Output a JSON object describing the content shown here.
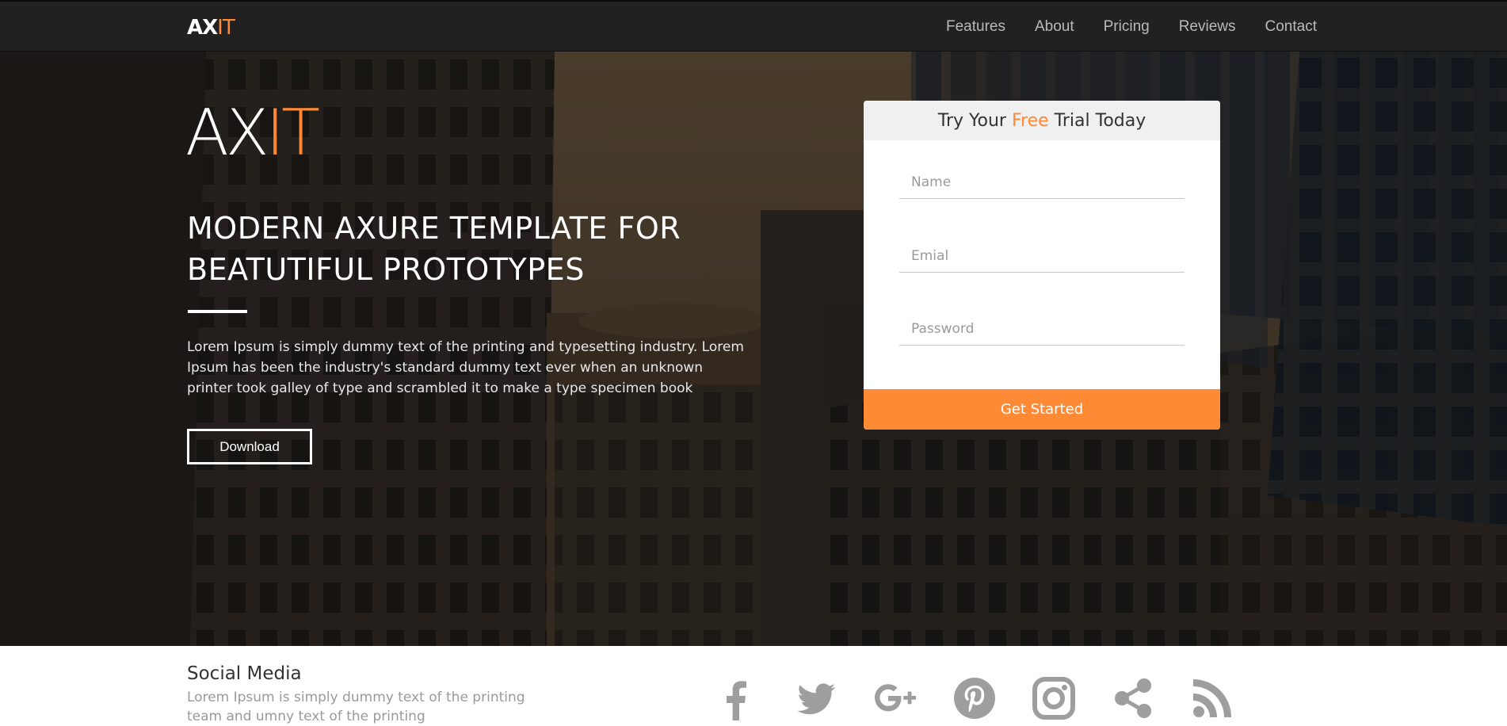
{
  "nav": {
    "brand_main": "AX",
    "brand_accent": "IT",
    "links": [
      "Features",
      "About",
      "Pricing",
      "Reviews",
      "Contact"
    ]
  },
  "hero": {
    "logo_main": "AX",
    "logo_accent": "IT",
    "title": "MODERN AXURE TEMPLATE FOR BEATUTIFUL PROTOTYPES",
    "body": "Lorem Ipsum is simply dummy text of the printing and typesetting industry. Lorem Ipsum has been the industry's standard dummy text ever when an unknown printer took galley of type and scrambled it to make a type specimen book",
    "download_label": "Download"
  },
  "trial": {
    "title_before": "Try Your ",
    "title_accent": "Free",
    "title_after": " Trial Today",
    "name_placeholder": "Name",
    "email_placeholder": "Emial",
    "password_placeholder": "Password",
    "cta_label": "Get Started"
  },
  "social": {
    "title": "Social Media",
    "text": "Lorem Ipsum is simply dummy text of the printing team and umny text of the printing",
    "icons": [
      "facebook-icon",
      "twitter-icon",
      "google-plus-icon",
      "pinterest-icon",
      "instagram-icon",
      "share-icon",
      "rss-icon"
    ]
  },
  "colors": {
    "accent": "#ff8a35",
    "navbar": "#212121",
    "icon_gray": "#9e9e9e"
  }
}
